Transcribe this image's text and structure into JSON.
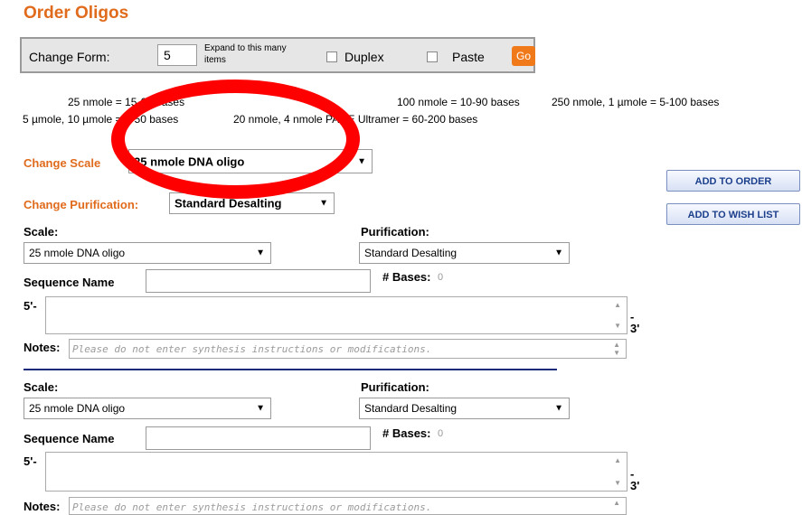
{
  "page": {
    "title": "Order Oligos"
  },
  "change_form": {
    "label": "Change Form:",
    "count_value": "5",
    "expand_text": "Expand to this many items",
    "duplex_label": "Duplex",
    "paste_label": "Paste",
    "go_label": "Go"
  },
  "info": {
    "line1_a": "25 nmole = 15-60 bases",
    "line1_b": "100 nmole =  10-90 bases",
    "line1_c": "250 nmole, 1 µmole = 5-100 bases",
    "line2_a": "5 µmole, 10 µmole =  5-50 bases",
    "line2_b": "20 nmole, 4 nmole PAGE Ultramer = 60-200 bases"
  },
  "change_scale": {
    "label": "Change Scale",
    "value": "25 nmole DNA oligo"
  },
  "change_purification": {
    "label": "Change Purification:",
    "value": "Standard Desalting"
  },
  "actions": {
    "add_to_order": "ADD TO ORDER",
    "add_to_wish_list": "ADD TO WISH LIST"
  },
  "items": [
    {
      "scale_label": "Scale:",
      "scale_value": "25 nmole DNA oligo",
      "purification_label": "Purification:",
      "purification_value": "Standard Desalting",
      "sequence_name_label": "Sequence Name",
      "sequence_name_value": "",
      "bases_label": "# Bases:",
      "bases_count": "0",
      "five_prime": "5'-",
      "three_prime_dash": "-",
      "three_prime": "3'",
      "notes_label": "Notes:",
      "notes_placeholder": "Please do not enter synthesis instructions or modifications."
    },
    {
      "scale_label": "Scale:",
      "scale_value": "25 nmole DNA oligo",
      "purification_label": "Purification:",
      "purification_value": "Standard Desalting",
      "sequence_name_label": "Sequence Name",
      "sequence_name_value": "",
      "bases_label": "# Bases:",
      "bases_count": "0",
      "five_prime": "5'-",
      "three_prime_dash": "-",
      "three_prime": "3'",
      "notes_label": "Notes:",
      "notes_placeholder": "Please do not enter synthesis instructions or modifications."
    }
  ],
  "colors": {
    "accent_orange": "#e06b1c",
    "go_button": "#f07a1a",
    "divider": "#1a2a7a",
    "annotation_oval": "#ff0000"
  }
}
